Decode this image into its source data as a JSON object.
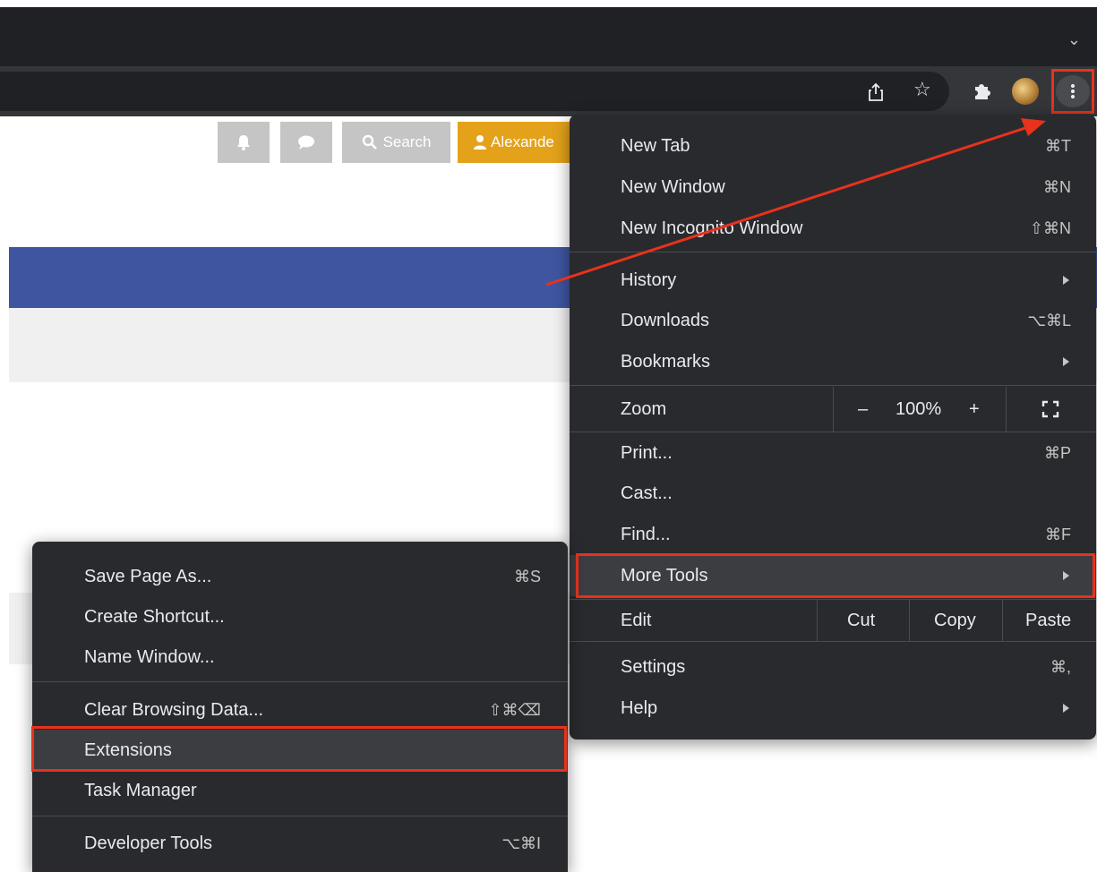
{
  "page": {
    "notification_icon": "bell-icon",
    "chat_icon": "chat-bubble-icon",
    "search_label": "Search",
    "user_label": "Alexande"
  },
  "toolbar": {
    "icons": [
      "share-icon",
      "star-icon",
      "puzzle-icon",
      "profile-avatar",
      "kebab-menu-icon"
    ]
  },
  "main_menu": {
    "new_tab": {
      "label": "New Tab",
      "shortcut": "⌘T"
    },
    "new_window": {
      "label": "New Window",
      "shortcut": "⌘N"
    },
    "new_incognito": {
      "label": "New Incognito Window",
      "shortcut": "⇧⌘N"
    },
    "history": {
      "label": "History"
    },
    "downloads": {
      "label": "Downloads",
      "shortcut": "⌥⌘L"
    },
    "bookmarks": {
      "label": "Bookmarks"
    },
    "zoom": {
      "label": "Zoom",
      "minus": "–",
      "value": "100%",
      "plus": "+"
    },
    "print": {
      "label": "Print...",
      "shortcut": "⌘P"
    },
    "cast": {
      "label": "Cast..."
    },
    "find": {
      "label": "Find...",
      "shortcut": "⌘F"
    },
    "more_tools": {
      "label": "More Tools"
    },
    "edit": {
      "label": "Edit",
      "cut": "Cut",
      "copy": "Copy",
      "paste": "Paste"
    },
    "settings": {
      "label": "Settings",
      "shortcut": "⌘,"
    },
    "help": {
      "label": "Help"
    }
  },
  "submenu": {
    "save_page": {
      "label": "Save Page As...",
      "shortcut": "⌘S"
    },
    "create_shortcut": {
      "label": "Create Shortcut..."
    },
    "name_window": {
      "label": "Name Window..."
    },
    "clear_data": {
      "label": "Clear Browsing Data...",
      "shortcut": "⇧⌘⌫"
    },
    "extensions": {
      "label": "Extensions"
    },
    "task_manager": {
      "label": "Task Manager"
    },
    "dev_tools": {
      "label": "Developer Tools",
      "shortcut": "⌥⌘I"
    }
  },
  "colors": {
    "highlight": "#e8321c",
    "menu_bg": "#292a2d",
    "accent_blue": "#3f55a0",
    "user_orange": "#e3a21a"
  }
}
